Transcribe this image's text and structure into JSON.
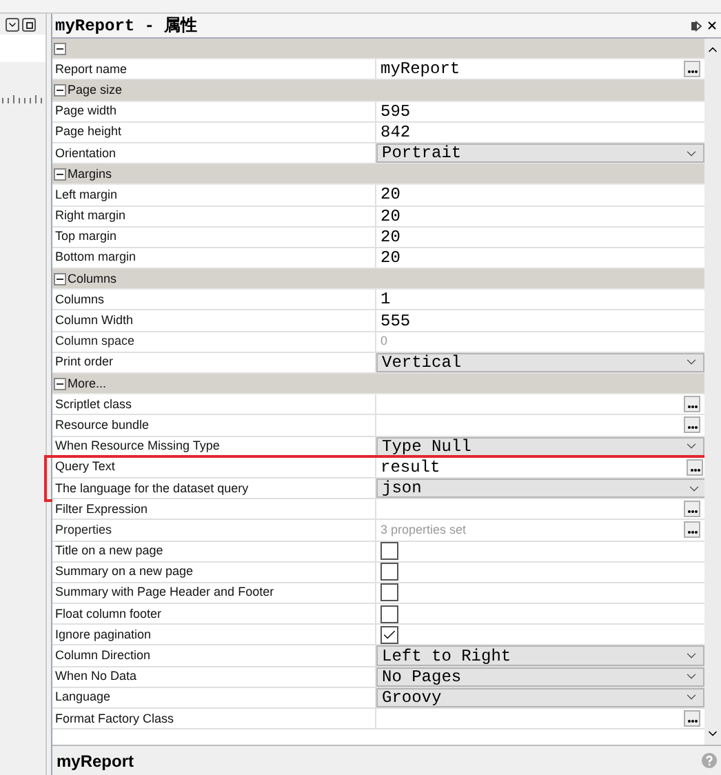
{
  "panel": {
    "title": "myReport - 属性"
  },
  "rows": [
    {
      "kind": "section",
      "label": "",
      "expanded": true
    },
    {
      "kind": "button",
      "label": "Report name",
      "value": "myReport"
    },
    {
      "kind": "section",
      "label": "Page size",
      "expanded": true
    },
    {
      "kind": "text",
      "label": "Page width",
      "value": "595"
    },
    {
      "kind": "text",
      "label": "Page height",
      "value": "842"
    },
    {
      "kind": "dropdown",
      "label": "Orientation",
      "value": "Portrait"
    },
    {
      "kind": "section",
      "label": "Margins",
      "expanded": true
    },
    {
      "kind": "text",
      "label": "Left margin",
      "value": "20"
    },
    {
      "kind": "text",
      "label": "Right margin",
      "value": "20"
    },
    {
      "kind": "text",
      "label": "Top margin",
      "value": "20"
    },
    {
      "kind": "text",
      "label": "Bottom margin",
      "value": "20"
    },
    {
      "kind": "section",
      "label": "Columns",
      "expanded": true
    },
    {
      "kind": "text",
      "label": "Columns",
      "value": "1"
    },
    {
      "kind": "text",
      "label": "Column Width",
      "value": "555"
    },
    {
      "kind": "text",
      "label": "Column space",
      "value": "0",
      "disabled": true
    },
    {
      "kind": "dropdown",
      "label": "Print order",
      "value": "Vertical"
    },
    {
      "kind": "section",
      "label": "More...",
      "expanded": true
    },
    {
      "kind": "button",
      "label": "Scriptlet class",
      "value": ""
    },
    {
      "kind": "button",
      "label": "Resource bundle",
      "value": ""
    },
    {
      "kind": "dropdown",
      "label": "When Resource Missing Type",
      "value": "Type Null"
    },
    {
      "kind": "button",
      "label": "Query Text",
      "value": "result",
      "highlighted": true
    },
    {
      "kind": "dropdown",
      "label": "The language for the dataset query",
      "value": "json",
      "highlighted": true
    },
    {
      "kind": "button",
      "label": "Filter Expression",
      "value": ""
    },
    {
      "kind": "button",
      "label": "Properties",
      "value": "3 properties set",
      "disabled": true
    },
    {
      "kind": "checkbox",
      "label": "Title on a new page",
      "checked": false
    },
    {
      "kind": "checkbox",
      "label": "Summary on a new page",
      "checked": false
    },
    {
      "kind": "checkbox",
      "label": "Summary with Page Header and Footer",
      "checked": false
    },
    {
      "kind": "checkbox",
      "label": "Float column footer",
      "checked": false
    },
    {
      "kind": "checkbox",
      "label": "Ignore pagination",
      "checked": true
    },
    {
      "kind": "dropdown",
      "label": "Column Direction",
      "value": "Left to Right"
    },
    {
      "kind": "dropdown",
      "label": "When No Data",
      "value": "No Pages"
    },
    {
      "kind": "dropdown",
      "label": "Language",
      "value": "Groovy"
    },
    {
      "kind": "button",
      "label": "Format Factory Class",
      "value": ""
    }
  ],
  "footer": {
    "title": "myReport"
  }
}
